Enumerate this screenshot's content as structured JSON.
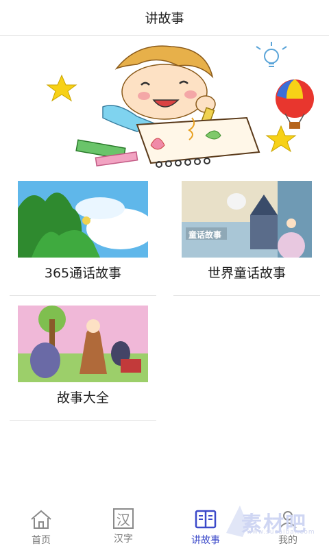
{
  "header": {
    "title": "讲故事"
  },
  "stories": [
    {
      "label": "365通话故事"
    },
    {
      "label": "世界童话故事",
      "thumb_caption": "童话故事"
    },
    {
      "label": "故事大全"
    }
  ],
  "tabbar": {
    "items": [
      {
        "label": "首页",
        "icon": "home-icon"
      },
      {
        "label": "汉字",
        "icon": "hanzi-icon",
        "glyph": "汉"
      },
      {
        "label": "讲故事",
        "icon": "book-icon",
        "active": true
      },
      {
        "label": "我的",
        "icon": "profile-icon"
      }
    ]
  },
  "watermark": {
    "text": "素材吧",
    "url": "www.sucaibar.com"
  },
  "colors": {
    "accent": "#3b49c9",
    "inactive": "#7a7a7a",
    "divider": "#e3e3e3"
  }
}
